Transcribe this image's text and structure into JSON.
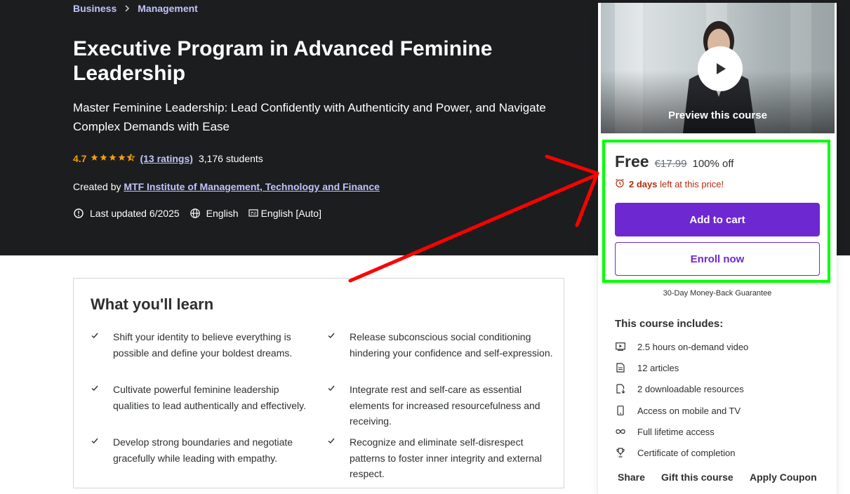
{
  "breadcrumb": {
    "items": [
      "Business",
      "Management"
    ]
  },
  "course": {
    "title": "Executive Program in Advanced Feminine Leadership",
    "subtitle": "Master Feminine Leadership: Lead Confidently with Authenticity and Power, and Navigate Complex Demands with Ease",
    "rating": "4.7",
    "ratings_link": "(13 ratings)",
    "students": "3,176 students",
    "created_by_label": "Created by",
    "instructor": "MTF Institute of Management, Technology and Finance",
    "last_updated": "Last updated 6/2025",
    "language": "English",
    "captions": "English [Auto]"
  },
  "learn": {
    "title": "What you'll learn",
    "items": [
      "Shift your identity to believe everything is possible and define your boldest dreams.",
      "Release subconscious social conditioning hindering your confidence and self-expression.",
      "Cultivate powerful feminine leadership qualities to lead authentically and effectively.",
      "Integrate rest and self-care as essential elements for increased resourcefulness and receiving.",
      "Develop strong boundaries and negotiate gracefully while leading with empathy.",
      "Recognize and eliminate self-disrespect patterns to foster inner integrity and external respect."
    ]
  },
  "sidebar": {
    "preview_label": "Preview this course",
    "price": "Free",
    "original_price": "€17.99",
    "discount": "100% off",
    "timer_days": "2 days",
    "timer_rest": "left at this price!",
    "add_to_cart": "Add to cart",
    "enroll_now": "Enroll now",
    "guarantee": "30-Day Money-Back Guarantee",
    "includes_title": "This course includes:",
    "includes": [
      "2.5 hours on-demand video",
      "12 articles",
      "2 downloadable resources",
      "Access on mobile and TV",
      "Full lifetime access",
      "Certificate of completion"
    ],
    "links": [
      "Share",
      "Gift this course",
      "Apply Coupon"
    ]
  },
  "colors": {
    "hero_bg": "#1c1d1f",
    "accent_purple": "#6d28d2",
    "link_lavender": "#c0c4fc",
    "star_orange": "#f69c08",
    "timer_red": "#b32d0f",
    "annotation_green": "#00ff00",
    "annotation_red": "#ff0000"
  },
  "icons": [
    "chevron-right-icon",
    "star-icon",
    "alert-badge-icon",
    "globe-icon",
    "captions-icon",
    "check-icon",
    "play-icon",
    "alarm-clock-icon",
    "video-icon",
    "article-icon",
    "download-file-icon",
    "mobile-icon",
    "infinity-icon",
    "trophy-icon"
  ]
}
